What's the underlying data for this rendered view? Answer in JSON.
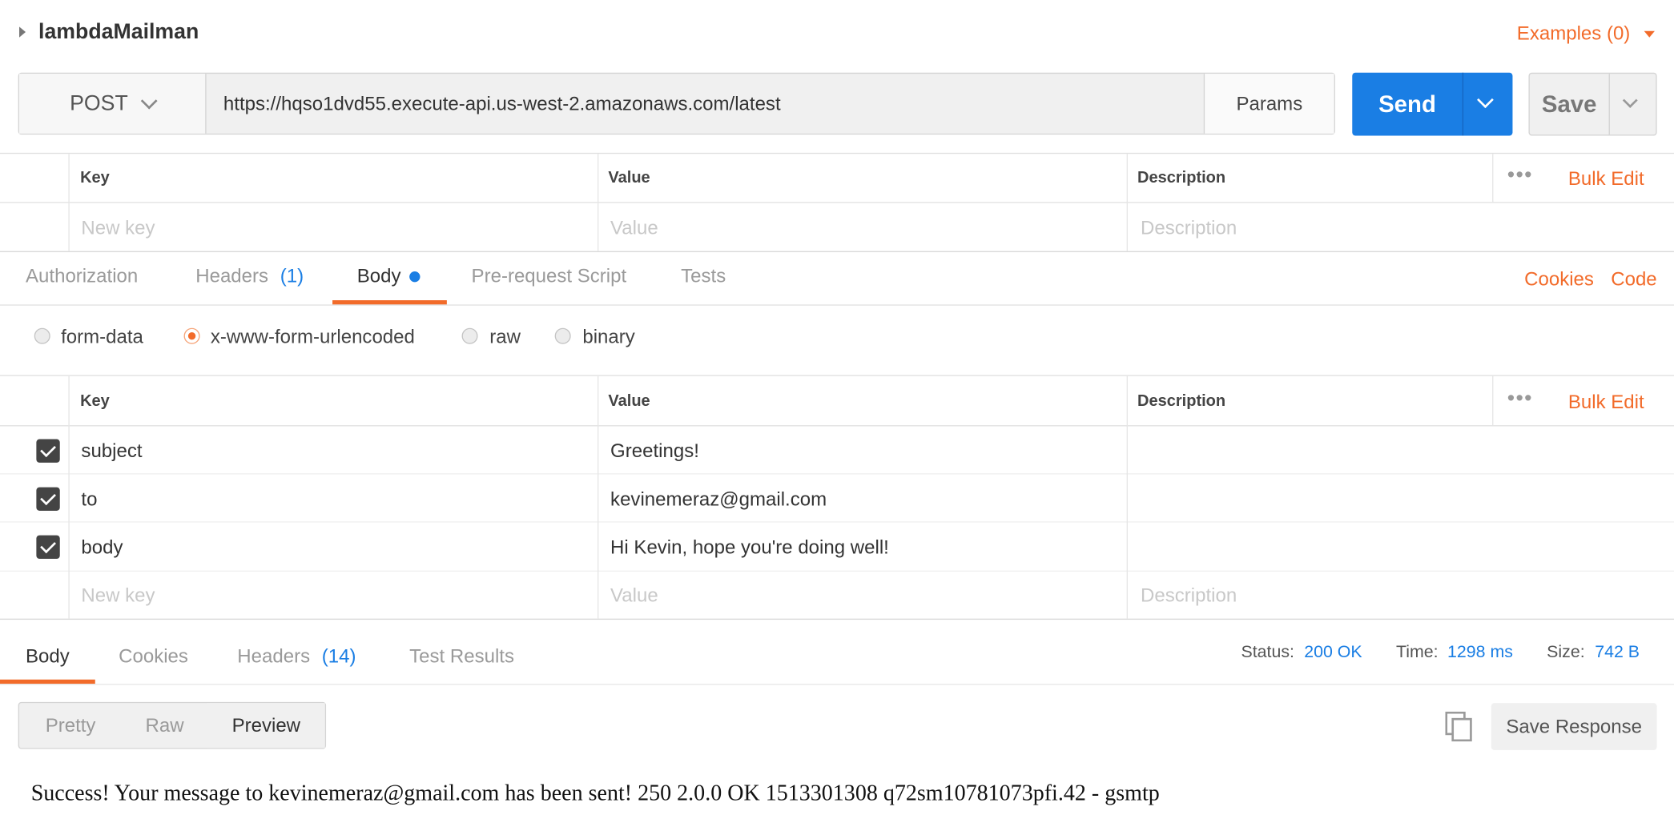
{
  "collection": {
    "name": "lambdaMailman",
    "examples_label": "Examples (0)"
  },
  "request": {
    "method": "POST",
    "url": "https://hqso1dvd55.execute-api.us-west-2.amazonaws.com/latest",
    "params_label": "Params",
    "send_label": "Send",
    "save_label": "Save"
  },
  "params_table": {
    "headers": {
      "key": "Key",
      "value": "Value",
      "description": "Description"
    },
    "bulk_edit": "Bulk Edit",
    "placeholder": {
      "key": "New key",
      "value": "Value",
      "description": "Description"
    }
  },
  "request_tabs": {
    "authorization": "Authorization",
    "headers": "Headers",
    "headers_count": "(1)",
    "body": "Body",
    "prerequest": "Pre-request Script",
    "tests": "Tests",
    "cookies": "Cookies",
    "code": "Code"
  },
  "body_modes": {
    "form_data": "form-data",
    "urlencoded": "x-www-form-urlencoded",
    "raw": "raw",
    "binary": "binary",
    "selected": "x-www-form-urlencoded"
  },
  "body_table": {
    "headers": {
      "key": "Key",
      "value": "Value",
      "description": "Description"
    },
    "bulk_edit": "Bulk Edit",
    "rows": [
      {
        "checked": true,
        "key": "subject",
        "value": "Greetings!"
      },
      {
        "checked": true,
        "key": "to",
        "value": "kevinemeraz@gmail.com"
      },
      {
        "checked": true,
        "key": "body",
        "value": "Hi Kevin, hope you're doing well!"
      }
    ],
    "placeholder": {
      "key": "New key",
      "value": "Value",
      "description": "Description"
    }
  },
  "response": {
    "tabs": {
      "body": "Body",
      "cookies": "Cookies",
      "headers": "Headers",
      "headers_count": "(14)",
      "test_results": "Test Results"
    },
    "status_label": "Status:",
    "status": "200 OK",
    "time_label": "Time:",
    "time": "1298 ms",
    "size_label": "Size:",
    "size": "742 B",
    "views": {
      "pretty": "Pretty",
      "raw": "Raw",
      "preview": "Preview"
    },
    "save_response": "Save Response",
    "output": "Success! Your message to kevinemeraz@gmail.com has been sent! 250 2.0.0 OK 1513301308 q72sm10781073pfi.42 - gsmtp"
  },
  "colors": {
    "accent": "#f26b2a",
    "send": "#1a7ee4"
  }
}
